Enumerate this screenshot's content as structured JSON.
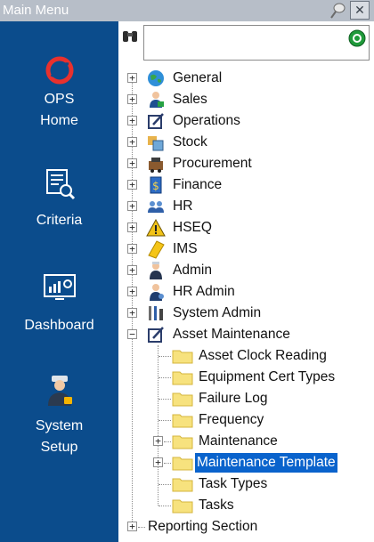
{
  "window": {
    "title": "Main Menu",
    "close_glyph": "✕",
    "pin_icon": "pin-icon"
  },
  "sidebar": {
    "background": "#0b4c8c",
    "items": [
      {
        "label_line1": "OPS",
        "label_line2": "Home",
        "icon": "ops-logo-icon"
      },
      {
        "label_line1": "Criteria",
        "label_line2": "",
        "icon": "criteria-icon"
      },
      {
        "label_line1": "Dashboard",
        "label_line2": "",
        "icon": "dashboard-icon"
      },
      {
        "label_line1": "System",
        "label_line2": "Setup",
        "icon": "system-setup-icon"
      }
    ]
  },
  "search": {
    "value": "",
    "placeholder": "",
    "search_icon": "binoculars-icon",
    "go_icon": "go-icon"
  },
  "tree": {
    "top_level": [
      {
        "label": "General",
        "icon": "globe-icon",
        "expander": "+"
      },
      {
        "label": "Sales",
        "icon": "sales-icon",
        "expander": "+"
      },
      {
        "label": "Operations",
        "icon": "operations-icon",
        "expander": "+"
      },
      {
        "label": "Stock",
        "icon": "stock-icon",
        "expander": "+"
      },
      {
        "label": "Procurement",
        "icon": "procurement-icon",
        "expander": "+"
      },
      {
        "label": "Finance",
        "icon": "finance-icon",
        "expander": "+"
      },
      {
        "label": "HR",
        "icon": "hr-icon",
        "expander": "+"
      },
      {
        "label": "HSEQ",
        "icon": "warning-icon",
        "expander": "+"
      },
      {
        "label": "IMS",
        "icon": "ims-icon",
        "expander": "+"
      },
      {
        "label": "Admin",
        "icon": "admin-icon",
        "expander": "+"
      },
      {
        "label": "HR Admin",
        "icon": "hr-admin-icon",
        "expander": "+"
      },
      {
        "label": "System Admin",
        "icon": "system-admin-icon",
        "expander": "+"
      },
      {
        "label": "Asset Maintenance",
        "icon": "asset-maintenance-icon",
        "expander": "−"
      }
    ],
    "asset_children": [
      {
        "label": "Asset Clock Reading",
        "expander": ""
      },
      {
        "label": "Equipment Cert Types",
        "expander": ""
      },
      {
        "label": "Failure Log",
        "expander": ""
      },
      {
        "label": "Frequency",
        "expander": ""
      },
      {
        "label": "Maintenance",
        "expander": "+"
      },
      {
        "label": "Maintenance Template",
        "expander": "+",
        "selected": true
      },
      {
        "label": "Task Types",
        "expander": ""
      },
      {
        "label": "Tasks",
        "expander": ""
      }
    ],
    "reporting": {
      "label": "Reporting Section",
      "expander": "+"
    },
    "selection_color": "#0a63cc"
  }
}
